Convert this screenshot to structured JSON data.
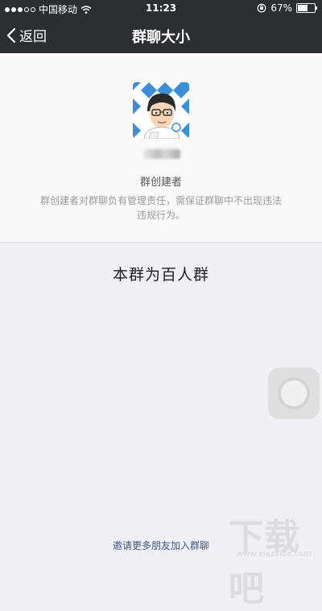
{
  "status_bar": {
    "carrier": "中国移动",
    "time": "11:23",
    "battery": "67%",
    "battery_level": 0.67,
    "signal_bars_filled": 3,
    "signal_bars_total": 5
  },
  "nav": {
    "back_label": "返回",
    "title": "群聊大小"
  },
  "creator": {
    "role": "群创建者",
    "description": "群创建者对群聊负有管理责任，需保证群聊中不出现违法违规行为。"
  },
  "group_limit": "本群为百人群",
  "invite_link": "邀请更多朋友加入群聊",
  "watermark": {
    "text": "下载吧",
    "url": "www.xiazaiba.com"
  },
  "colors": {
    "navbar": "#2d2e32",
    "background": "#efeff4",
    "panel": "#f9f9f9",
    "link": "#3d5b86",
    "avatar_pattern": "#3a8fd6"
  }
}
